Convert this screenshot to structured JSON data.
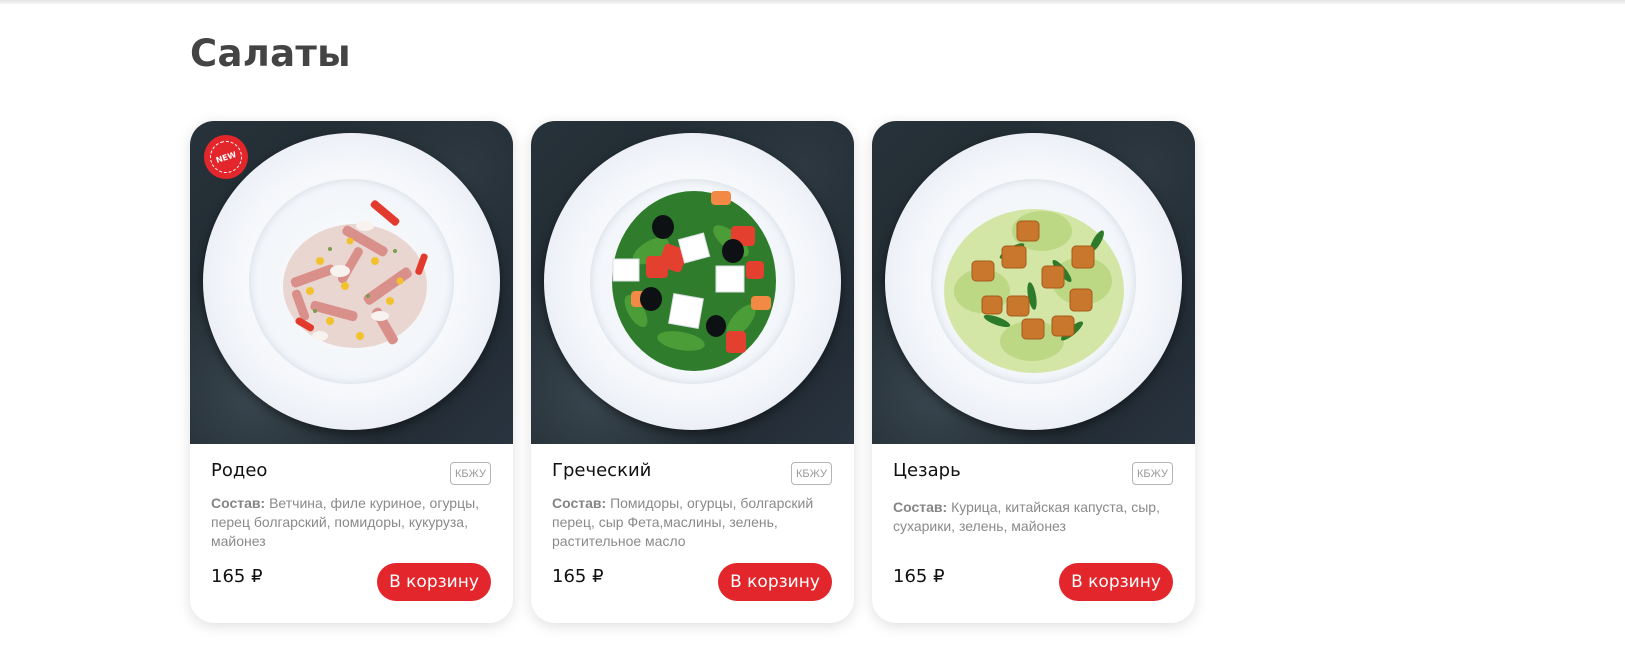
{
  "section": {
    "title": "Салаты"
  },
  "colors": {
    "accent": "#e3262b",
    "title": "#444444",
    "text": "#111111",
    "muted": "#8a8a8a"
  },
  "products": [
    {
      "name": "Родео",
      "badge": "NEW",
      "kbju_label": "КБЖУ",
      "composition_label": "Состав:",
      "composition": " Ветчина, филе куриное, огурцы, перец болгарский, помидоры, кукуруза, майонез",
      "price": "165 ₽",
      "button_label": "В корзину"
    },
    {
      "name": "Греческий",
      "kbju_label": "КБЖУ",
      "composition_label": "Состав:",
      "composition": " Помидоры, огурцы, болгарский перец, сыр Фета,маслины, зелень, растительное масло",
      "price": "165 ₽",
      "button_label": "В корзину"
    },
    {
      "name": "Цезарь",
      "kbju_label": "КБЖУ",
      "composition_label": "Состав:",
      "composition": " Курица, китайская капуста, сыр, сухарики, зелень, майонез",
      "price": "165 ₽",
      "button_label": "В корзину"
    }
  ]
}
